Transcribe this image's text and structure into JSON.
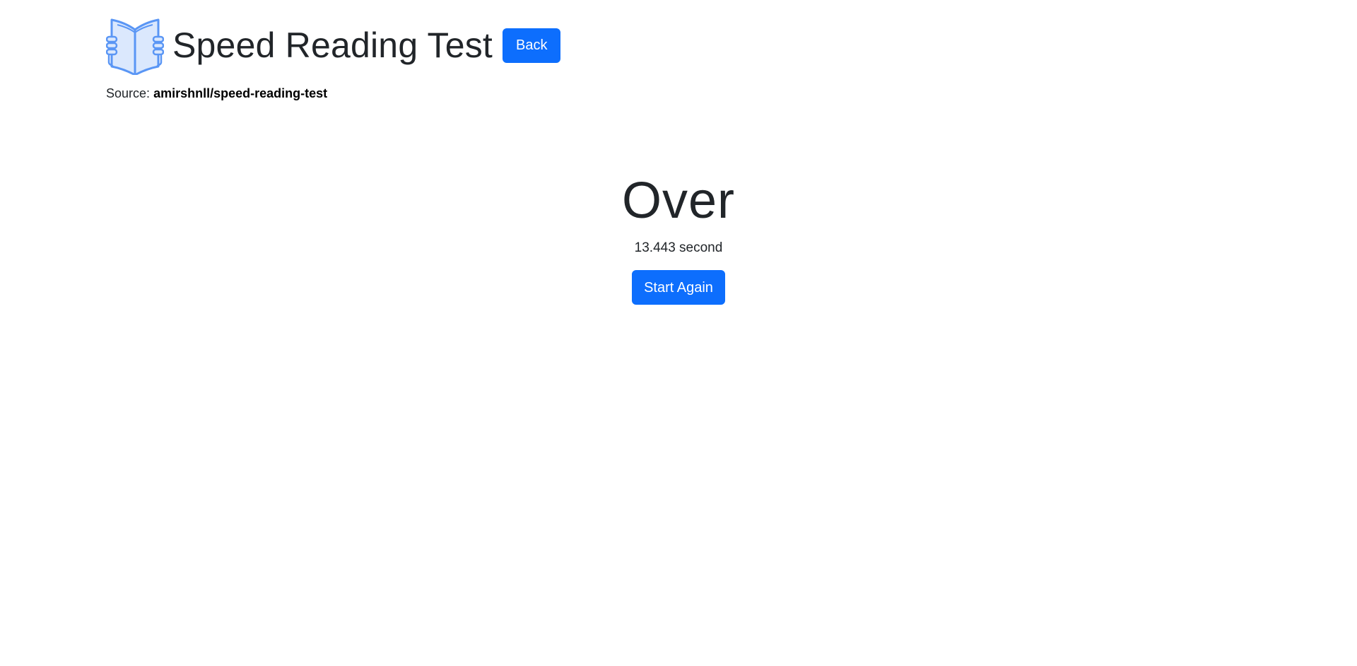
{
  "header": {
    "title": "Speed Reading Test",
    "back_label": "Back",
    "logo_icon": "open-book-icon"
  },
  "source": {
    "prefix": "Source:",
    "repo": "amirshnll/speed-reading-test"
  },
  "result": {
    "title": "Over",
    "time_text": "13.443 second",
    "restart_label": "Start Again"
  },
  "colors": {
    "primary": "#0d6efd",
    "text": "#212529",
    "logo_stroke": "#5a96f5",
    "logo_fill": "#dbe8fd"
  }
}
